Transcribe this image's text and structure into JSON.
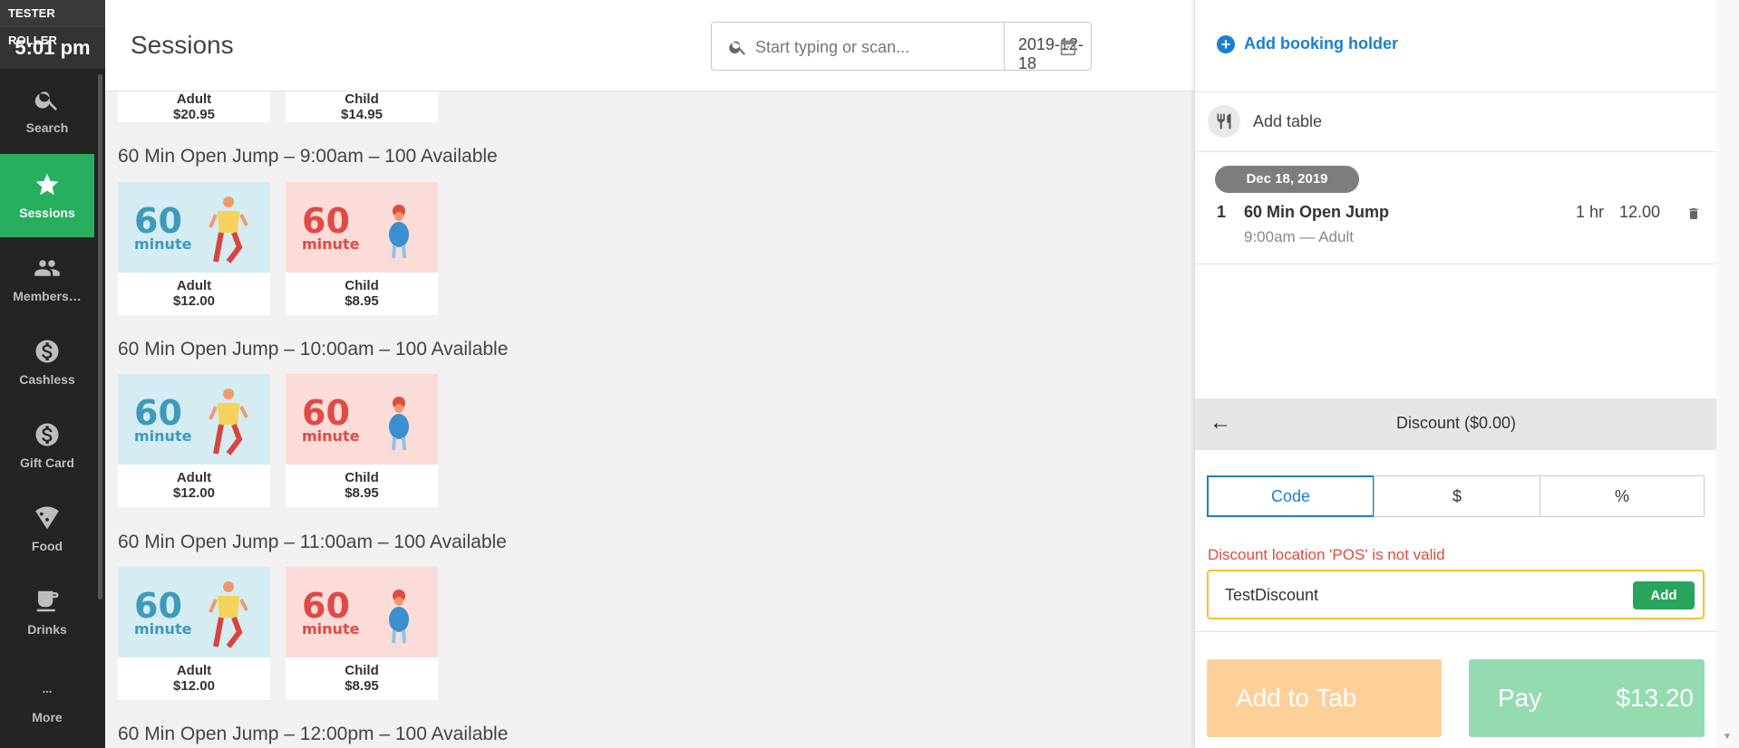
{
  "nav": {
    "brand": "TESTER ROLLER",
    "time": "5:01 pm",
    "items": [
      {
        "label": "Search",
        "icon": "search-icon"
      },
      {
        "label": "Sessions",
        "icon": "star-icon"
      },
      {
        "label": "Members…",
        "icon": "people-icon"
      },
      {
        "label": "Cashless",
        "icon": "dollar-circle-icon"
      },
      {
        "label": "Gift Card",
        "icon": "dollar-circle-icon"
      },
      {
        "label": "Food",
        "icon": "pizza-icon"
      },
      {
        "label": "Drinks",
        "icon": "cup-icon"
      },
      {
        "label": "More",
        "icon": "more-icon"
      }
    ],
    "active_color": "#27ae5f"
  },
  "header": {
    "title": "Sessions",
    "search_placeholder": "Start typing or scan...",
    "date": "2019-12-18"
  },
  "partial_cards": [
    {
      "label": "Adult",
      "price": "$20.95"
    },
    {
      "label": "Child",
      "price": "$14.95"
    }
  ],
  "sessions": [
    {
      "title": "60 Min Open Jump – 9:00am – 100 Available",
      "cards": [
        {
          "type": "adult",
          "big": "60",
          "small": "minute",
          "label": "Adult",
          "price": "$12.00"
        },
        {
          "type": "child",
          "big": "60",
          "small": "minute",
          "label": "Child",
          "price": "$8.95"
        }
      ]
    },
    {
      "title": "60 Min Open Jump – 10:00am – 100 Available",
      "cards": [
        {
          "type": "adult",
          "big": "60",
          "small": "minute",
          "label": "Adult",
          "price": "$12.00"
        },
        {
          "type": "child",
          "big": "60",
          "small": "minute",
          "label": "Child",
          "price": "$8.95"
        }
      ]
    },
    {
      "title": "60 Min Open Jump – 11:00am – 100 Available",
      "cards": [
        {
          "type": "adult",
          "big": "60",
          "small": "minute",
          "label": "Adult",
          "price": "$12.00"
        },
        {
          "type": "child",
          "big": "60",
          "small": "minute",
          "label": "Child",
          "price": "$8.95"
        }
      ]
    },
    {
      "title": "60 Min Open Jump – 12:00pm – 100 Available",
      "cards": []
    }
  ],
  "panel": {
    "add_booking_holder": "Add booking holder",
    "add_table": "Add table",
    "date_pill": "Dec 18, 2019",
    "line_item": {
      "qty": "1",
      "name": "60 Min Open Jump",
      "sub": "9:00am — Adult",
      "duration": "1 hr",
      "price": "12.00"
    },
    "discount": {
      "back": "←",
      "title": "Discount ($0.00)",
      "tabs": [
        "Code",
        "$",
        "%"
      ],
      "active_tab": "Code",
      "error": "Discount location 'POS' is not valid",
      "code_value": "TestDiscount",
      "add_label": "Add"
    },
    "add_to_tab": "Add to Tab",
    "pay_label": "Pay",
    "pay_amount": "$13.20"
  }
}
